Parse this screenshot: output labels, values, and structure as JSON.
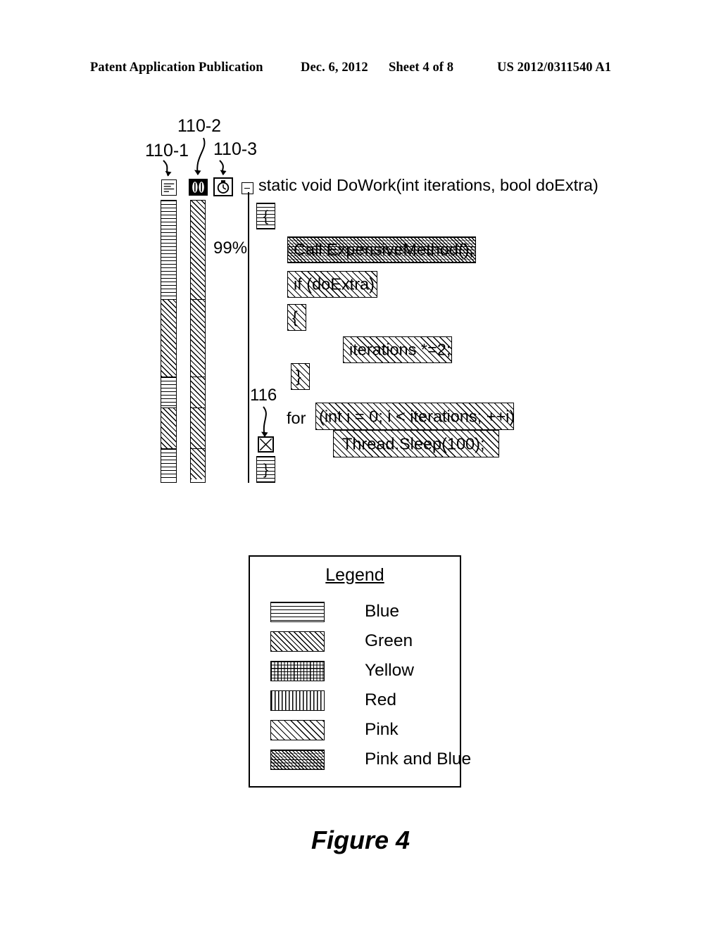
{
  "page_header": {
    "publication": "Patent Application Publication",
    "date": "Dec. 6, 2012",
    "sheet": "Sheet 4 of 8",
    "patent_number": "US 2012/0311540 A1"
  },
  "figure": {
    "caption": "Figure 4",
    "callouts": [
      {
        "id": "110-1",
        "label": "110-1"
      },
      {
        "id": "110-2",
        "label": "110-2"
      },
      {
        "id": "110-3",
        "label": "110-3"
      },
      {
        "id": "116",
        "label": "116"
      }
    ],
    "toolbar_icons": [
      {
        "name": "document-lines-icon",
        "callout": "110-1"
      },
      {
        "name": "pause-bars-icon",
        "callout": "110-2"
      },
      {
        "name": "stopwatch-icon",
        "callout": "110-3"
      }
    ],
    "percent_marker": "99%",
    "code": {
      "signature": "static void DoWork(int iterations, bool doExtra)",
      "lines": [
        {
          "glyph": "{",
          "text": "",
          "fill": "blue"
        },
        {
          "glyph": "",
          "text": "Call ExpensiveMethod();",
          "fill": "pink-and-blue"
        },
        {
          "glyph": "",
          "text": "if (doExtra)",
          "fill": "pink"
        },
        {
          "glyph": "",
          "text": "{",
          "fill": "pink"
        },
        {
          "glyph": "",
          "text": "iterations *=2;",
          "fill": "pink"
        },
        {
          "glyph": "",
          "text": "}",
          "fill": "pink"
        },
        {
          "glyph": "x-box-icon",
          "prefix": "for",
          "text": "(int i = 0;  i < iterations; ++i)",
          "fill": "pink"
        },
        {
          "glyph": "",
          "text": "Thread.Sleep(100);",
          "fill": "pink"
        },
        {
          "glyph": "}",
          "text": "",
          "fill": "blue"
        }
      ],
      "for_keyword": "for",
      "for_condition": "(int i = 0;  i < iterations; ++i)",
      "sleep_stmt": "Thread.Sleep(100);",
      "call_stmt": "Call ExpensiveMethod();",
      "if_stmt": "if (doExtra)",
      "open_brace": "{",
      "close_brace": "}",
      "iterations_stmt": "iterations *=2;"
    },
    "bar_1_segments": [
      {
        "fill": "blue",
        "height_pct": 35.0
      },
      {
        "fill": "green",
        "height_pct": 27.5
      },
      {
        "fill": "blue",
        "height_pct": 11.0
      },
      {
        "fill": "green",
        "height_pct": 14.5
      },
      {
        "fill": "blue",
        "height_pct": 12.0
      }
    ],
    "bar_2_segments": [
      {
        "fill": "green",
        "height_pct": 35.0
      },
      {
        "fill": "green",
        "height_pct": 27.5
      },
      {
        "fill": "green",
        "height_pct": 11.0
      },
      {
        "fill": "green",
        "height_pct": 14.5
      },
      {
        "fill": "green",
        "height_pct": 12.0
      }
    ]
  },
  "legend": {
    "title": "Legend",
    "entries": [
      {
        "pattern": "horizontal-lines",
        "label": "Blue"
      },
      {
        "pattern": "diagonal-medium",
        "label": "Green"
      },
      {
        "pattern": "grid",
        "label": "Yellow"
      },
      {
        "pattern": "vertical-lines",
        "label": "Red"
      },
      {
        "pattern": "diagonal-sparse",
        "label": "Pink"
      },
      {
        "pattern": "diagonal-dense",
        "label": "Pink and Blue"
      }
    ]
  }
}
